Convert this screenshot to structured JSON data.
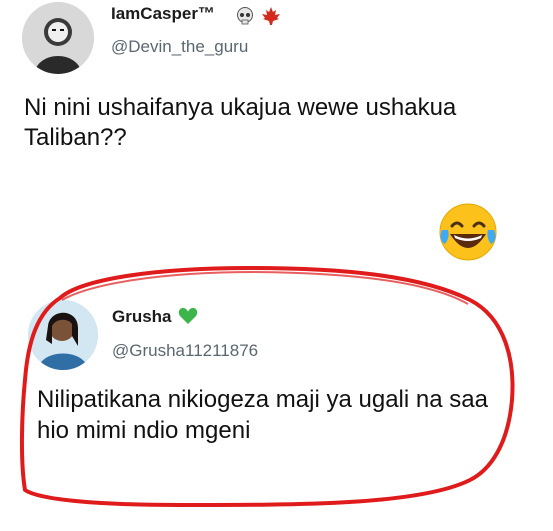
{
  "tweets": [
    {
      "name": "IamCasper™",
      "handle": "@Devin_the_guru",
      "badges": [
        "skull-emoji",
        "maple-leaf-emoji"
      ],
      "text": "Ni nini ushaifanya ukajua wewe ushakua Taliban??"
    },
    {
      "name": "Grusha",
      "name_badge": "green-heart-emoji",
      "handle": "@Grusha11211876",
      "text": "Nilipatikana nikiogeza maji ya ugali na saa hio mimi ndio mgeni"
    }
  ],
  "reaction": {
    "icon": "laughing-tears-emoji"
  },
  "colors": {
    "highlight_stroke": "#e01b1b",
    "name_text": "#1c1c1c",
    "handle_text": "#5b6770",
    "heart": "#3cb54a"
  }
}
